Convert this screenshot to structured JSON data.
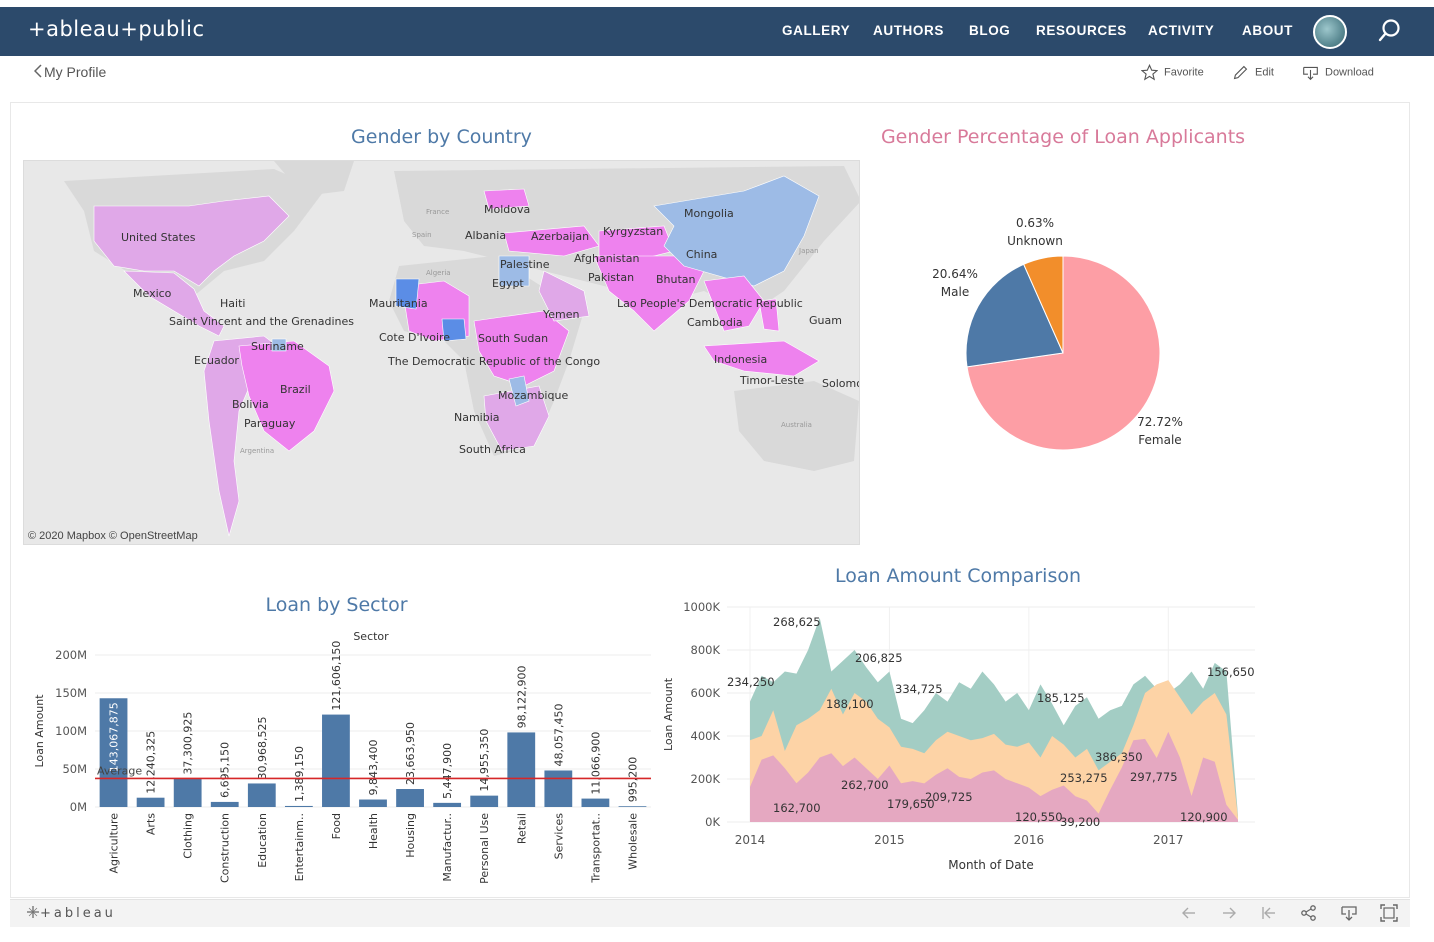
{
  "header": {
    "logo": "+ableau+public",
    "nav": [
      "GALLERY",
      "AUTHORS",
      "BLOG",
      "RESOURCES",
      "ACTIVITY",
      "ABOUT"
    ]
  },
  "subbar": {
    "back_label": "My Profile",
    "favorite_label": "Favorite",
    "edit_label": "Edit",
    "download_label": "Download"
  },
  "map_panel": {
    "title": "Gender by Country",
    "credit": "© 2020 Mapbox © OpenStreetMap",
    "country_labels": [
      "United States",
      "Mexico",
      "Haiti",
      "Saint Vincent and the Grenadines",
      "Suriname",
      "Ecuador",
      "Brazil",
      "Bolivia",
      "Paraguay",
      "Mauritania",
      "Cote D'Ivoire",
      "The Democratic Republic of the Congo",
      "South Sudan",
      "Mozambique",
      "Namibia",
      "South Africa",
      "Moldova",
      "Albania",
      "Azerbaijan",
      "Palestine",
      "Egypt",
      "Yemen",
      "Kyrgyzstan",
      "Afghanistan",
      "Pakistan",
      "Bhutan",
      "Mongolia",
      "China",
      "Lao People's Democratic Republic",
      "Cambodia",
      "Indonesia",
      "Timor-Leste",
      "Guam",
      "Solomo"
    ],
    "base_labels": [
      "France",
      "Spain",
      "Algeria",
      "Japan",
      "Argentina",
      "Australia"
    ],
    "colors": {
      "female_majority": "#ee82ee",
      "mixed": "#e0a8e8",
      "male_majority": "#9dbbe6",
      "male_strong": "#5b8de6",
      "no_data": "#d9d9d9"
    }
  },
  "pie_panel": {
    "title": "Gender Percentage of Loan Applicants",
    "slices": [
      {
        "label": "Female",
        "pct": "72.72%",
        "value": 72.72,
        "color": "#fd9ea5"
      },
      {
        "label": "Male",
        "pct": "20.64%",
        "value": 20.64,
        "color": "#4e79a7"
      },
      {
        "label": "Unknown",
        "pct": "0.63%",
        "value": 6.64,
        "color": "#f28e2b"
      }
    ]
  },
  "sector_panel": {
    "title": "Loan by Sector"
  },
  "comparison_panel": {
    "title": "Loan Amount Comparison"
  },
  "chart_data": [
    {
      "type": "bar",
      "title": "Loan by Sector",
      "xlabel": "Sector",
      "ylabel": "Loan Amount",
      "ylim": [
        0,
        200000000
      ],
      "yticks": [
        "0M",
        "50M",
        "100M",
        "150M",
        "200M"
      ],
      "categories": [
        "Agriculture",
        "Arts",
        "Clothing",
        "Construction",
        "Education",
        "Entertainm..",
        "Food",
        "Health",
        "Housing",
        "Manufactur..",
        "Personal Use",
        "Retail",
        "Services",
        "Transportat..",
        "Wholesale"
      ],
      "values": [
        143067875,
        12240325,
        37300925,
        6695150,
        30968525,
        1389150,
        121606150,
        9843400,
        23663950,
        5447900,
        14955350,
        98122900,
        48057450,
        11066900,
        995200
      ],
      "value_labels": [
        "143,067,875",
        "12,240,325",
        "37,300,925",
        "6,695,150",
        "30,968,525",
        "1,389,150",
        "121,606,150",
        "9,843,400",
        "23,663,950",
        "5,447,900",
        "14,955,350",
        "98,122,900",
        "48,057,450",
        "11,066,900",
        "995,200"
      ],
      "reference_line": {
        "label": "Average",
        "value": 37641000,
        "color": "#d62728"
      },
      "bar_color": "#4e79a7",
      "grid": true
    },
    {
      "type": "area",
      "title": "Loan Amount Comparison",
      "xlabel": "Month of Date",
      "ylabel": "Loan Amount",
      "ylim": [
        0,
        1000000
      ],
      "yticks": [
        "0K",
        "200K",
        "400K",
        "600K",
        "800K",
        "1000K"
      ],
      "xticks": [
        "2014",
        "2015",
        "2016",
        "2017"
      ],
      "x_start": "2014-01",
      "x_end": "2017-07",
      "series": [
        {
          "color": "#e5a8c1",
          "values": [
            162700,
            290000,
            310000,
            250000,
            180000,
            230000,
            300000,
            320000,
            260000,
            300000,
            250000,
            200000,
            262700,
            180000,
            190000,
            179650,
            220000,
            250000,
            209725,
            200000,
            230000,
            240000,
            200000,
            180000,
            160000,
            120550,
            150000,
            170000,
            120000,
            100000,
            39200,
            150000,
            253275,
            380000,
            386350,
            297775,
            420000,
            300000,
            120900,
            300000,
            280000,
            80000,
            10000
          ]
        },
        {
          "color": "#fdd3a6",
          "values": [
            380000,
            400000,
            520000,
            330000,
            450000,
            480000,
            520000,
            620000,
            500000,
            600000,
            560000,
            480000,
            440000,
            350000,
            340000,
            320000,
            380000,
            420000,
            400000,
            380000,
            390000,
            410000,
            360000,
            350000,
            370000,
            300000,
            400000,
            360000,
            300000,
            340000,
            240000,
            280000,
            320000,
            450000,
            600000,
            640000,
            660000,
            580000,
            500000,
            560000,
            600000,
            500000,
            20000
          ]
        },
        {
          "color": "#a3cdc4",
          "values": [
            560000,
            680000,
            650000,
            700000,
            690000,
            800000,
            950000,
            700000,
            750000,
            800000,
            720000,
            650000,
            700000,
            480000,
            460000,
            520000,
            600000,
            560000,
            650000,
            620000,
            700000,
            640000,
            560000,
            600000,
            520000,
            640000,
            550000,
            450000,
            540000,
            580000,
            480000,
            520000,
            540000,
            640000,
            680000,
            620000,
            600000,
            640000,
            700000,
            620000,
            740000,
            700000,
            30000
          ]
        }
      ],
      "data_labels": [
        {
          "text": "268,625"
        },
        {
          "text": "234,250"
        },
        {
          "text": "206,825"
        },
        {
          "text": "188,100"
        },
        {
          "text": "334,725"
        },
        {
          "text": "185,125"
        },
        {
          "text": "156,650"
        },
        {
          "text": "162,700"
        },
        {
          "text": "262,700"
        },
        {
          "text": "179,650"
        },
        {
          "text": "209,725"
        },
        {
          "text": "253,275"
        },
        {
          "text": "386,350"
        },
        {
          "text": "297,775"
        },
        {
          "text": "120,550"
        },
        {
          "text": "39,200"
        },
        {
          "text": "120,900"
        }
      ],
      "grid": true
    }
  ]
}
